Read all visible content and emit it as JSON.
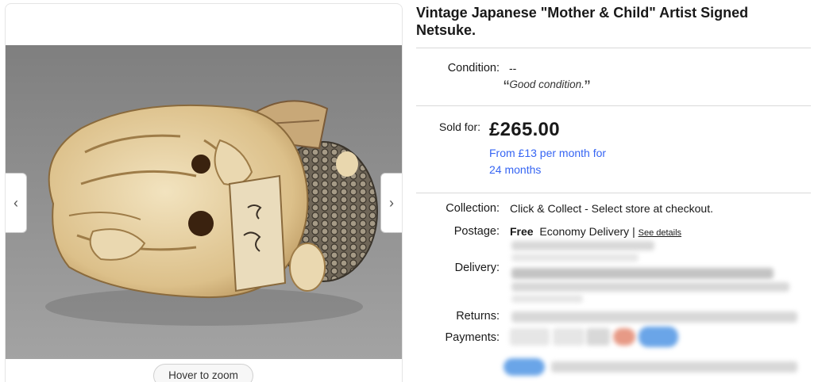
{
  "listing": {
    "title": "Vintage Japanese \"Mother & Child\" Artist Signed Netsuke."
  },
  "gallery": {
    "prev_icon": "chevron-left-icon",
    "next_icon": "chevron-right-icon",
    "prev_glyph": "‹",
    "next_glyph": "›",
    "zoom_label": "Hover to zoom"
  },
  "condition": {
    "label": "Condition:",
    "value": "--",
    "open_quote": "“",
    "description": "Good condition.",
    "close_quote": "”"
  },
  "price": {
    "label": "Sold for:",
    "amount": "£265.00",
    "finance_line1": "From £13 per month for",
    "finance_line2": "24 months"
  },
  "collection": {
    "label": "Collection:",
    "value": "Click & Collect - Select store at checkout."
  },
  "postage": {
    "label": "Postage:",
    "free": "Free",
    "service": "Economy Delivery",
    "separator": "|",
    "see_details": "See details"
  },
  "delivery": {
    "label": "Delivery:"
  },
  "returns": {
    "label": "Returns:"
  },
  "payments": {
    "label": "Payments:"
  }
}
